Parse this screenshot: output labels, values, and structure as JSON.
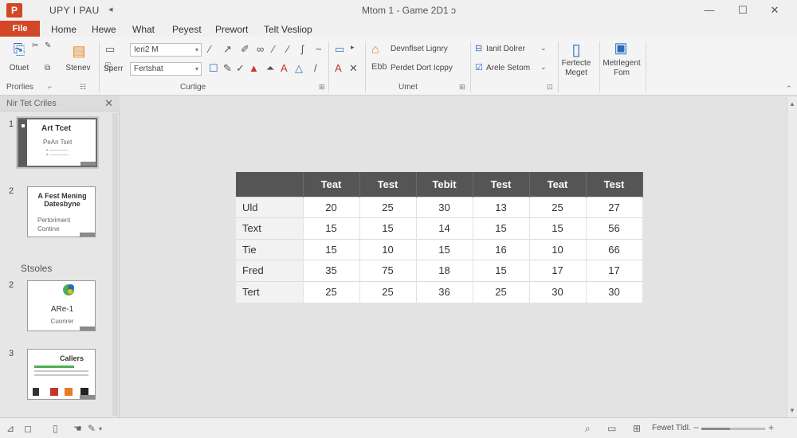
{
  "titlebar": {
    "app_logo": "P",
    "doc_name": "UPY I PAU",
    "quick_access": "◂",
    "window_title": "Mtom 1 - Game 2D1 ɔ",
    "minimize": "—",
    "restore": "☐",
    "close": "✕"
  },
  "menu": {
    "file": "File",
    "tabs": [
      "Home",
      "Hewe",
      "What",
      "Peyest",
      "Prewort",
      "Telt Vesliop"
    ]
  },
  "ribbon": {
    "clipboard": {
      "btn1": "Otuet",
      "btn2": "Stenev",
      "group_label": "Prorlies"
    },
    "font": {
      "font_name": "Ieri2 M",
      "font_size": "Fertshat",
      "btn_speed": "Sperr",
      "group_label": "Curtige"
    },
    "paragraph": {
      "item1": "Devnflset Lignry",
      "item2": "Perdet Dort Icppy",
      "group_label": "Umet"
    },
    "drawing": {
      "item1": "Ianit Dolrer",
      "item2": "Arele Setom",
      "group_label": ""
    },
    "big_btn1": "Fertecte\nMeget",
    "big_btn2": "Metrlegent\nFom"
  },
  "panel": {
    "title": "Nir Tet Criles",
    "close": "✕",
    "section": "Stsoles",
    "slides": [
      {
        "num": "1",
        "title": "Art Tcet",
        "subtitle": "PeAn Tset",
        "lines": "▪ ————\n▪ ————"
      },
      {
        "num": "2",
        "title": "A Fest Mening\nDatesbyne",
        "subtitle": "Pertoriment\nContine"
      },
      {
        "num": "2",
        "title": "ARe-1",
        "subtitle": "Cuonrer"
      },
      {
        "num": "3",
        "title": "Callers",
        "subtitle": ""
      }
    ]
  },
  "table": {
    "headers": [
      "",
      "Teat",
      "Test",
      "Tebit",
      "Test",
      "Teat",
      "Test"
    ],
    "rows": [
      [
        "Uld",
        "20",
        "25",
        "30",
        "13",
        "25",
        "27"
      ],
      [
        "Text",
        "15",
        "15",
        "14",
        "15",
        "15",
        "56"
      ],
      [
        "Tie",
        "15",
        "10",
        "15",
        "16",
        "10",
        "66"
      ],
      [
        "Fred",
        "35",
        "75",
        "18",
        "15",
        "17",
        "17"
      ],
      [
        "Tert",
        "25",
        "25",
        "36",
        "25",
        "30",
        "30"
      ]
    ]
  },
  "statusbar": {
    "view_label": "Fewet Tldl.",
    "zoom_minus": "−",
    "zoom_plus": "+",
    "zoom_level": 0.45
  }
}
